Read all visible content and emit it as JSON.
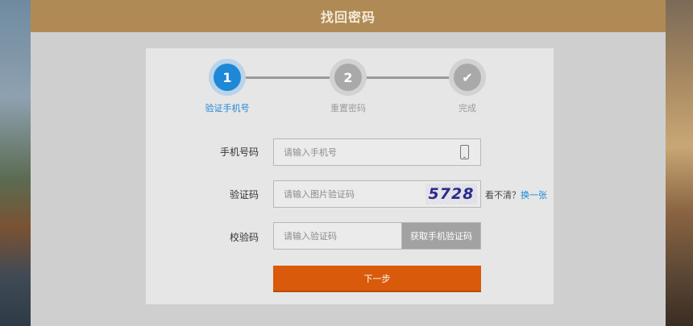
{
  "header": {
    "title": "找回密码"
  },
  "steps": [
    {
      "number": "1",
      "label": "验证手机号",
      "state": "active"
    },
    {
      "number": "2",
      "label": "重置密码",
      "state": "pending"
    },
    {
      "number": "✔",
      "label": "完成",
      "state": "pending"
    }
  ],
  "form": {
    "phone": {
      "label": "手机号码",
      "placeholder": "请输入手机号",
      "icon": "phone-icon"
    },
    "captcha": {
      "label": "验证码",
      "placeholder": "请输入图片验证码",
      "image_text": "5728",
      "hint": "看不清？",
      "refresh_link": "换一张"
    },
    "sms": {
      "label": "校验码",
      "placeholder": "请输入验证码",
      "button": "获取手机验证码"
    },
    "next_button": "下一步"
  },
  "colors": {
    "header": "#b08a55",
    "active_step": "#1e88d6",
    "primary_button": "#d95a0a",
    "link": "#1e88d6"
  }
}
